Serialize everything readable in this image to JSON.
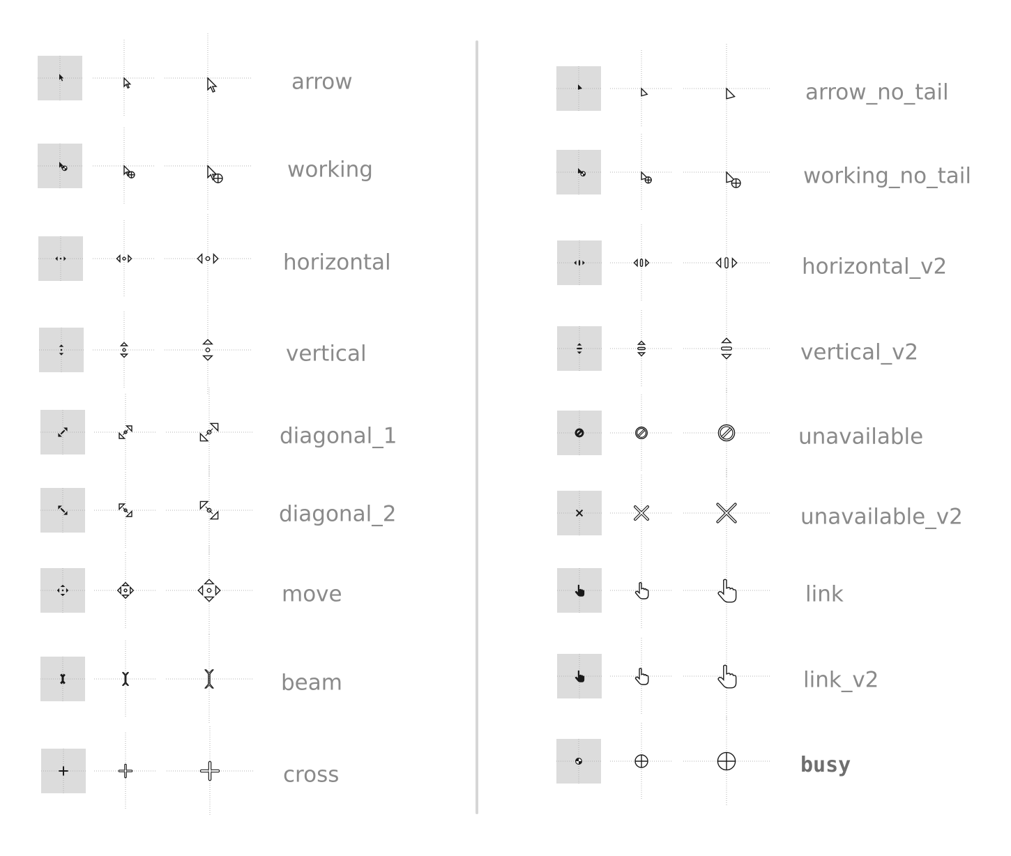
{
  "colors": {
    "small_tile_bg": "#dcdcdc",
    "crosshair": "#a8a8a8",
    "label_text": "#8a8a8a",
    "busy_label_text": "#6e6e6e",
    "divider": "#d6d6d6",
    "glyph_fill": "#1a1a1a",
    "glyph_outline": "#1a1a1a"
  },
  "columns": [
    {
      "name": "left",
      "cursors": [
        {
          "label": "arrow",
          "icon": "arrow-cursor-icon"
        },
        {
          "label": "working",
          "icon": "working-cursor-icon"
        },
        {
          "label": "horizontal",
          "icon": "horizontal-resize-icon"
        },
        {
          "label": "vertical",
          "icon": "vertical-resize-icon"
        },
        {
          "label": "diagonal_1",
          "icon": "diagonal-1-resize-icon"
        },
        {
          "label": "diagonal_2",
          "icon": "diagonal-2-resize-icon"
        },
        {
          "label": "move",
          "icon": "move-cursor-icon"
        },
        {
          "label": "beam",
          "icon": "beam-cursor-icon"
        },
        {
          "label": "cross",
          "icon": "cross-cursor-icon"
        }
      ]
    },
    {
      "name": "right",
      "cursors": [
        {
          "label": "arrow_no_tail",
          "icon": "arrow-no-tail-cursor-icon"
        },
        {
          "label": "working_no_tail",
          "icon": "working-no-tail-cursor-icon"
        },
        {
          "label": "horizontal_v2",
          "icon": "horizontal-v2-resize-icon"
        },
        {
          "label": "vertical_v2",
          "icon": "vertical-v2-resize-icon"
        },
        {
          "label": "unavailable",
          "icon": "unavailable-cursor-icon"
        },
        {
          "label": "unavailable_v2",
          "icon": "unavailable-v2-cursor-icon"
        },
        {
          "label": "link",
          "icon": "link-hand-cursor-icon"
        },
        {
          "label": "link_v2",
          "icon": "link-v2-hand-cursor-icon"
        },
        {
          "label": "busy",
          "icon": "busy-cursor-icon"
        }
      ]
    }
  ]
}
